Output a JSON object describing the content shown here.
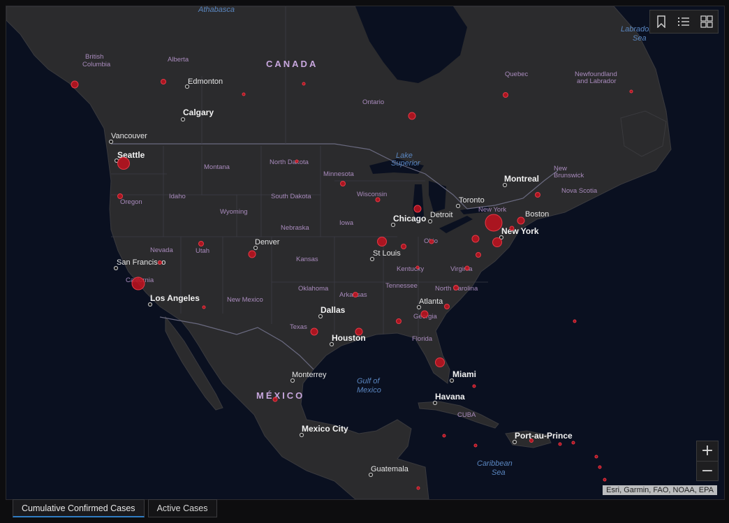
{
  "toolbar": {
    "icons": [
      "bookmark-icon",
      "legend-list-icon",
      "basemap-gallery-icon"
    ]
  },
  "zoom": {
    "in_label": "+",
    "out_label": "−"
  },
  "attribution": "Esri, Garmin, FAO, NOAA, EPA",
  "tabs": [
    {
      "label": "Cumulative Confirmed Cases",
      "active": true
    },
    {
      "label": "Active Cases",
      "active": false
    }
  ],
  "labels": {
    "athabasca": "Athabasca",
    "labrador_sea_1": "Labrador",
    "labrador_sea_2": "Sea",
    "british_columbia_1": "British",
    "british_columbia_2": "Columbia",
    "alberta": "Alberta",
    "canada": "CANADA",
    "edmonton": "Edmonton",
    "calgary": "Calgary",
    "quebec": "Quebec",
    "newfoundland_1": "Newfoundland",
    "newfoundland_2": "and Labrador",
    "ontario": "Ontario",
    "vancouver": "Vancouver",
    "seattle": "Seattle",
    "montana": "Montana",
    "north_dakota": "North Dakota",
    "lake_superior_1": "Lake",
    "lake_superior_2": "Superior",
    "minnesota": "Minnesota",
    "montreal": "Montreal",
    "new_brunswick_1": "New",
    "new_brunswick_2": "Brunswick",
    "nova_scotia": "Nova Scotia",
    "idaho": "Idaho",
    "oregon": "Oregon",
    "south_dakota": "South Dakota",
    "wisconsin": "Wisconsin",
    "toronto": "Toronto",
    "wyoming": "Wyoming",
    "detroit": "Detroit",
    "new_york_state": "New York",
    "boston": "Boston",
    "chicago": "Chicago",
    "iowa": "Iowa",
    "nebraska": "Nebraska",
    "new_york": "New York",
    "denver": "Denver",
    "nevada": "Nevada",
    "utah": "Utah",
    "ohio": "Ohio",
    "st_louis": "St Louis",
    "san_francisco": "San Francisco",
    "kansas": "Kansas",
    "kentucky": "Kentucky",
    "virginia": "Virginia",
    "california": "California",
    "tennessee": "Tennessee",
    "oklahoma": "Oklahoma",
    "north_carolina": "North Carolina",
    "los_angeles": "Los Angeles",
    "arkansas": "Arkansas",
    "new_mexico": "New Mexico",
    "atlanta": "Atlanta",
    "dallas": "Dallas",
    "georgia": "Georgia",
    "texas": "Texas",
    "houston": "Houston",
    "florida": "Florida",
    "monterrey": "Monterrey",
    "gulf_1": "Gulf of",
    "gulf_2": "Mexico",
    "miami": "Miami",
    "mexico": "MÉXICO",
    "havana": "Havana",
    "cuba": "CUBA",
    "mexico_city": "Mexico City",
    "port_au_prince": "Port-au-Prince",
    "caribbean_1": "Caribbean",
    "caribbean_2": "Sea",
    "guatemala": "Guatemala"
  },
  "colors": {
    "land": "#2b2b2d",
    "water": "#0a1020",
    "case_fill": "#c1121f",
    "borders": "#4a4a55"
  }
}
